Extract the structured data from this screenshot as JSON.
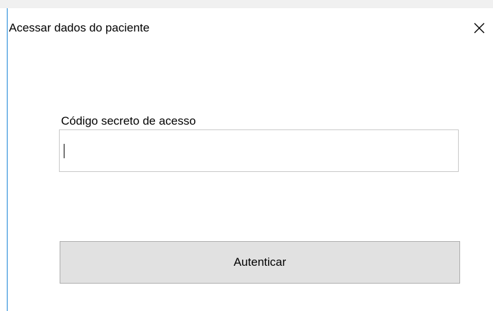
{
  "window": {
    "title": "Acessar dados do paciente",
    "close_icon": "close-icon"
  },
  "form": {
    "access_code_label": "Código secreto de acesso",
    "access_code_value": "",
    "access_code_placeholder": ""
  },
  "actions": {
    "authenticate_label": "Autenticar"
  },
  "colors": {
    "window_border": "#1883d7",
    "button_bg": "#e1e1e1",
    "button_border": "#adadad",
    "input_border": "#c8c8c8"
  }
}
